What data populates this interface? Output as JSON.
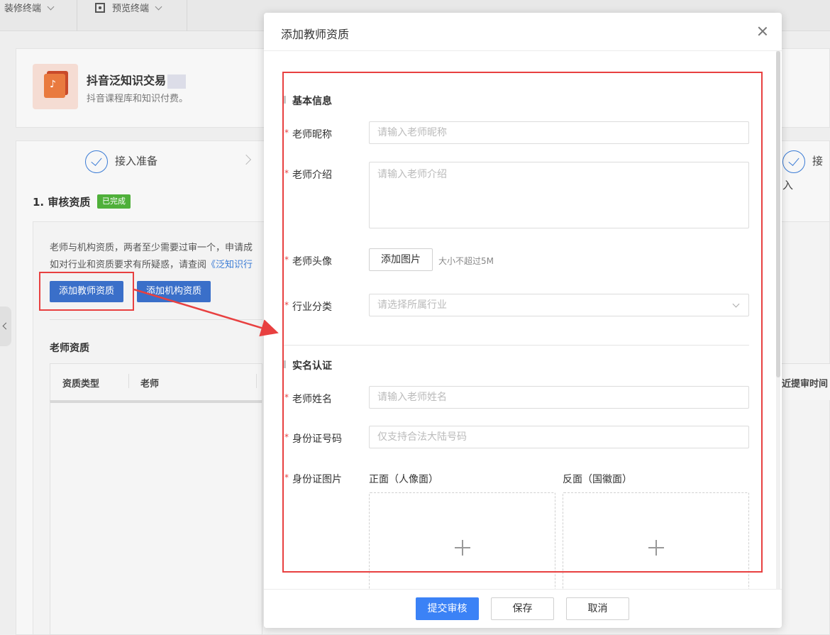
{
  "topbar": {
    "decor_label": "装修终端",
    "preview_label": "预览终端"
  },
  "app": {
    "title": "抖音泛知识交易",
    "subtitle": "抖音课程库和知识付费。",
    "logo_glyph": "♪"
  },
  "steps": [
    {
      "label": "接入准备"
    },
    {
      "label": "接入"
    }
  ],
  "qualification": {
    "section_title": "1. 审核资质",
    "badge": "已完成",
    "hint_line1": "老师与机构资质，两者至少需要过审一个，申请成",
    "hint_line2_prefix": "如对行业和资质要求有所疑惑，请查阅",
    "hint_line2_link": "《泛知识行",
    "add_teacher_button": "添加教师资质",
    "add_org_button": "添加机构资质",
    "teacher_table_title": "老师资质",
    "columns": [
      "资质类型",
      "老师"
    ],
    "right_column": "近提审时间"
  },
  "modal": {
    "title": "添加教师资质",
    "basic_section": "基本信息",
    "nickname_label": "老师昵称",
    "nickname_placeholder": "请输入老师昵称",
    "intro_label": "老师介绍",
    "intro_placeholder": "请输入老师介绍",
    "avatar_label": "老师头像",
    "avatar_button": "添加图片",
    "avatar_tip": "大小不超过5M",
    "industry_label": "行业分类",
    "industry_placeholder": "请选择所属行业",
    "realname_section": "实名认证",
    "name_label": "老师姓名",
    "name_placeholder": "请输入老师姓名",
    "idnum_label": "身份证号码",
    "idnum_placeholder": "仅支持合法大陆号码",
    "idimg_label": "身份证图片",
    "front_label": "正面（人像面）",
    "back_label": "反面（国徽面）",
    "required_mark": "*",
    "submit_button": "提交审核",
    "save_button": "保存",
    "cancel_button": "取消"
  },
  "colors": {
    "primary": "#3b82f6",
    "highlight": "#e84040",
    "success": "#4fb03a"
  }
}
